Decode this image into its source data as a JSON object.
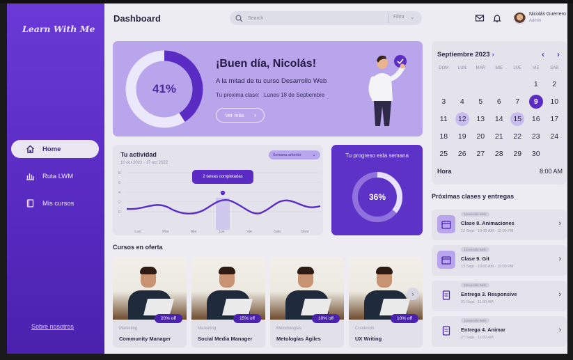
{
  "sidebar": {
    "logo": "Learn With Me",
    "items": [
      {
        "label": "Home",
        "icon": "home-icon",
        "active": true
      },
      {
        "label": "Ruta LWM",
        "icon": "chart-icon",
        "active": false
      },
      {
        "label": "Mis cursos",
        "icon": "book-icon",
        "active": false
      }
    ],
    "about": "Sobre nosotros"
  },
  "header": {
    "title": "Dashboard",
    "search_placeholder": "Search",
    "filter_label": "Filtro",
    "user_name": "Nicolás Guerrero",
    "user_role": "Admin"
  },
  "hero": {
    "progress_label": "41%",
    "progress_value": 41,
    "greeting": "¡Buen día, Nicolás!",
    "subtitle": "A la mitad de tu curso Desarrollo Web",
    "next_label": "Tu proxima clase:",
    "next_value": "Lunes 18 de Septiembre",
    "button_label": "Ver más"
  },
  "activity": {
    "title": "Tu actividad",
    "range": "10 oct 2022 - 17 oct 2022",
    "select_label": "Semana anterior",
    "tooltip": "2 tareas completadas",
    "y_ticks": [
      "8",
      "6",
      "4",
      "2",
      "0"
    ],
    "days": [
      "Lun",
      "Mar",
      "Mie",
      "Jue",
      "Vie",
      "Sab",
      "Dom"
    ]
  },
  "progress_card": {
    "title": "Tu progreso esta semana",
    "label": "36%",
    "value": 36
  },
  "courses": {
    "title": "Cursos en oferta",
    "items": [
      {
        "category": "Marketing",
        "name": "Community Manager",
        "discount": "20% off"
      },
      {
        "category": "Marketing",
        "name": "Social Media Manager",
        "discount": "15% off"
      },
      {
        "category": "Metodologías",
        "name": "Metologías Ágiles",
        "discount": "10% off"
      },
      {
        "category": "Contenido",
        "name": "UX Writing",
        "discount": "10% off"
      }
    ]
  },
  "calendar": {
    "month": "Septiembre 2023",
    "weekdays": [
      "DOM",
      "LUN",
      "MAR",
      "MIE",
      "JUE",
      "VIE",
      "SAB"
    ],
    "weeks": [
      [
        "",
        "",
        "",
        "",
        "",
        "1",
        "2"
      ],
      [
        "3",
        "4",
        "5",
        "6",
        "7",
        "9",
        "10"
      ],
      [
        "11",
        "12",
        "13",
        "14",
        "15",
        "16",
        "17"
      ],
      [
        "18",
        "19",
        "20",
        "21",
        "22",
        "23",
        "24"
      ],
      [
        "25",
        "26",
        "27",
        "28",
        "29",
        "30",
        ""
      ]
    ],
    "selected_day": "9",
    "highlighted_days": [
      "12",
      "15"
    ],
    "hour_label": "Hora",
    "hour_value": "8:00 AM"
  },
  "upcoming": {
    "title": "Próximas clases y entregas",
    "items": [
      {
        "tag": "Desarrollo Web",
        "name": "Clase 8. Animaciones",
        "date": "12 Sept · 10:00 AM  -  12:00 PM",
        "icon": "calendar-icon"
      },
      {
        "tag": "Desarrollo Web",
        "name": "Clase 9. Git",
        "date": "13 Sept · 10:00 AM  -  12:00 PM",
        "icon": "calendar-icon"
      },
      {
        "tag": "Desarrollo Web",
        "name": "Entrega 3. Responsive",
        "date": "21 Sept · 11:00 AM",
        "icon": "document-icon"
      },
      {
        "tag": "Desarrollo Web",
        "name": "Entrega 4. Animar",
        "date": "27 Sept · 11:00 AM",
        "icon": "document-icon"
      }
    ]
  },
  "colors": {
    "sidebar": "#5a2cc4",
    "accent": "#5a2cc4",
    "hero_bg": "#b9a5ec"
  }
}
